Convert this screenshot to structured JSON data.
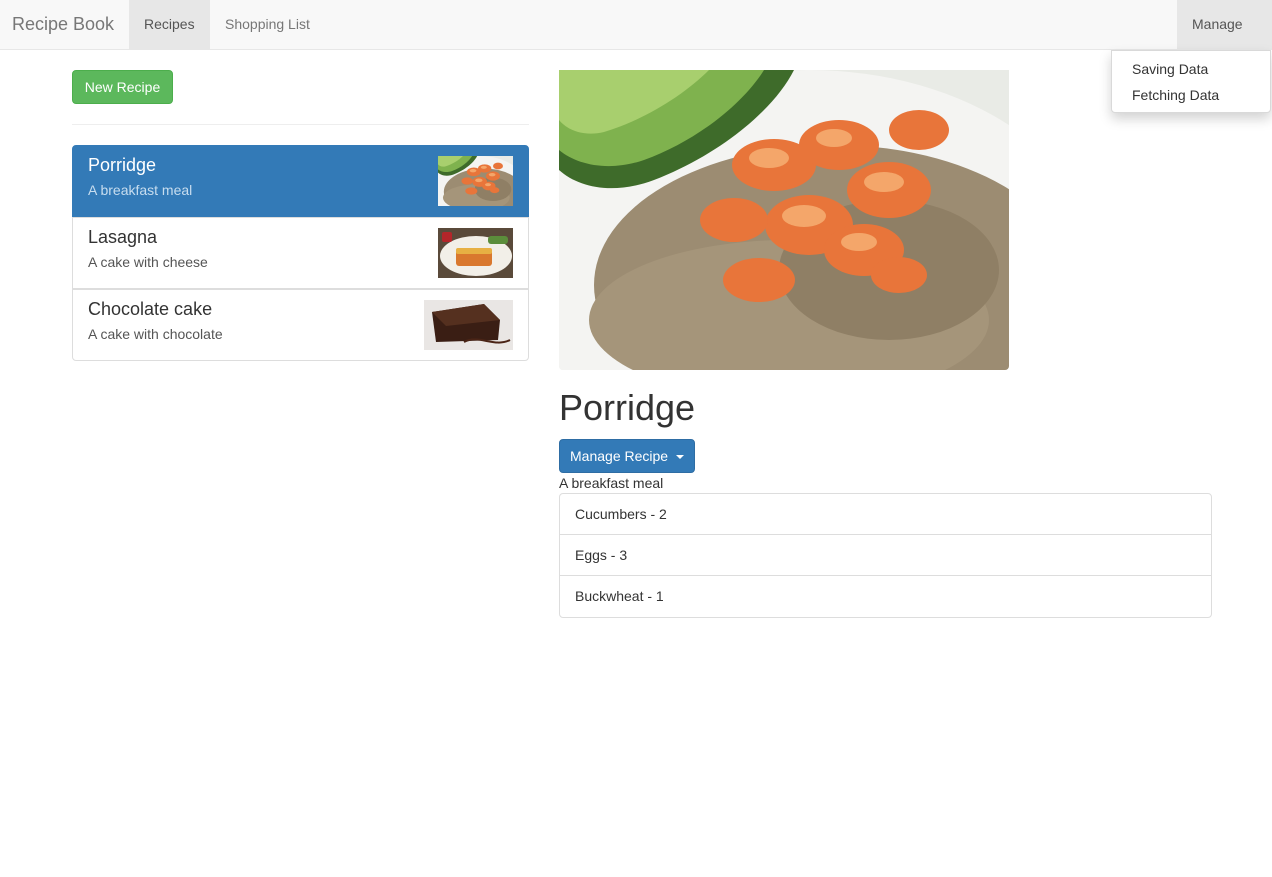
{
  "navbar": {
    "brand": "Recipe Book",
    "links": [
      {
        "label": "Recipes",
        "active": true
      },
      {
        "label": "Shopping List",
        "active": false
      }
    ],
    "manage": {
      "label": "Manage",
      "menu": [
        "Saving Data",
        "Fetching Data"
      ]
    }
  },
  "sidebar": {
    "new_recipe_label": "New Recipe",
    "recipes": [
      {
        "name": "Porridge",
        "description": "A breakfast meal",
        "active": true,
        "thumbnail": "shrimp-quinoa-photo"
      },
      {
        "name": "Lasagna",
        "description": "A cake with cheese",
        "active": false,
        "thumbnail": "lasagna-photo"
      },
      {
        "name": "Chocolate cake",
        "description": "A cake with chocolate",
        "active": false,
        "thumbnail": "chocolate-cake-photo"
      }
    ]
  },
  "detail": {
    "name": "Porridge",
    "manage_label": "Manage Recipe",
    "description": "A breakfast meal",
    "image": "shrimp-quinoa-photo",
    "ingredients": [
      "Cucumbers - 2",
      "Eggs - 3",
      "Buckwheat - 1"
    ]
  },
  "colors": {
    "primary": "#337ab7",
    "success": "#5cb85c",
    "navbar_bg": "#f8f8f8",
    "nav_active_bg": "#e7e7e7"
  }
}
